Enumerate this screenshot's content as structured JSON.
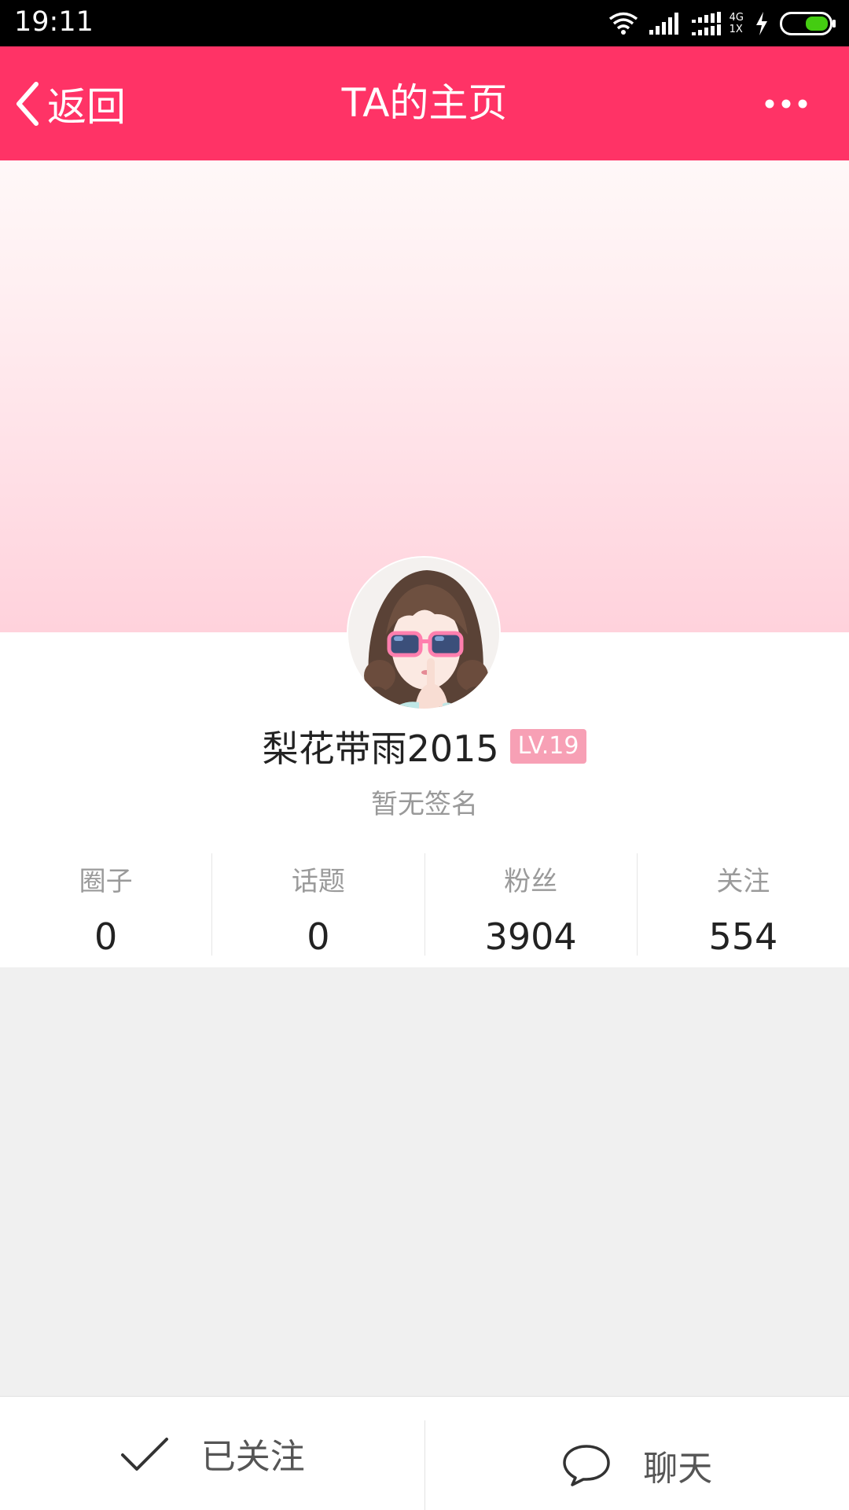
{
  "status_bar": {
    "time": "19:11",
    "network_top": "4G",
    "network_bottom": "1X"
  },
  "header": {
    "back_label": "返回",
    "title": "TA的主页"
  },
  "profile": {
    "username": "梨花带雨2015",
    "level": "LV.19",
    "signature": "暂无签名"
  },
  "stats": [
    {
      "label": "圈子",
      "value": "0"
    },
    {
      "label": "话题",
      "value": "0"
    },
    {
      "label": "粉丝",
      "value": "3904"
    },
    {
      "label": "关注",
      "value": "554"
    }
  ],
  "bottom_bar": {
    "follow_label": "已关注",
    "chat_label": "聊天"
  },
  "colors": {
    "brand": "#ff3366",
    "level_badge": "#f7a0b5",
    "battery": "#44cc11"
  }
}
